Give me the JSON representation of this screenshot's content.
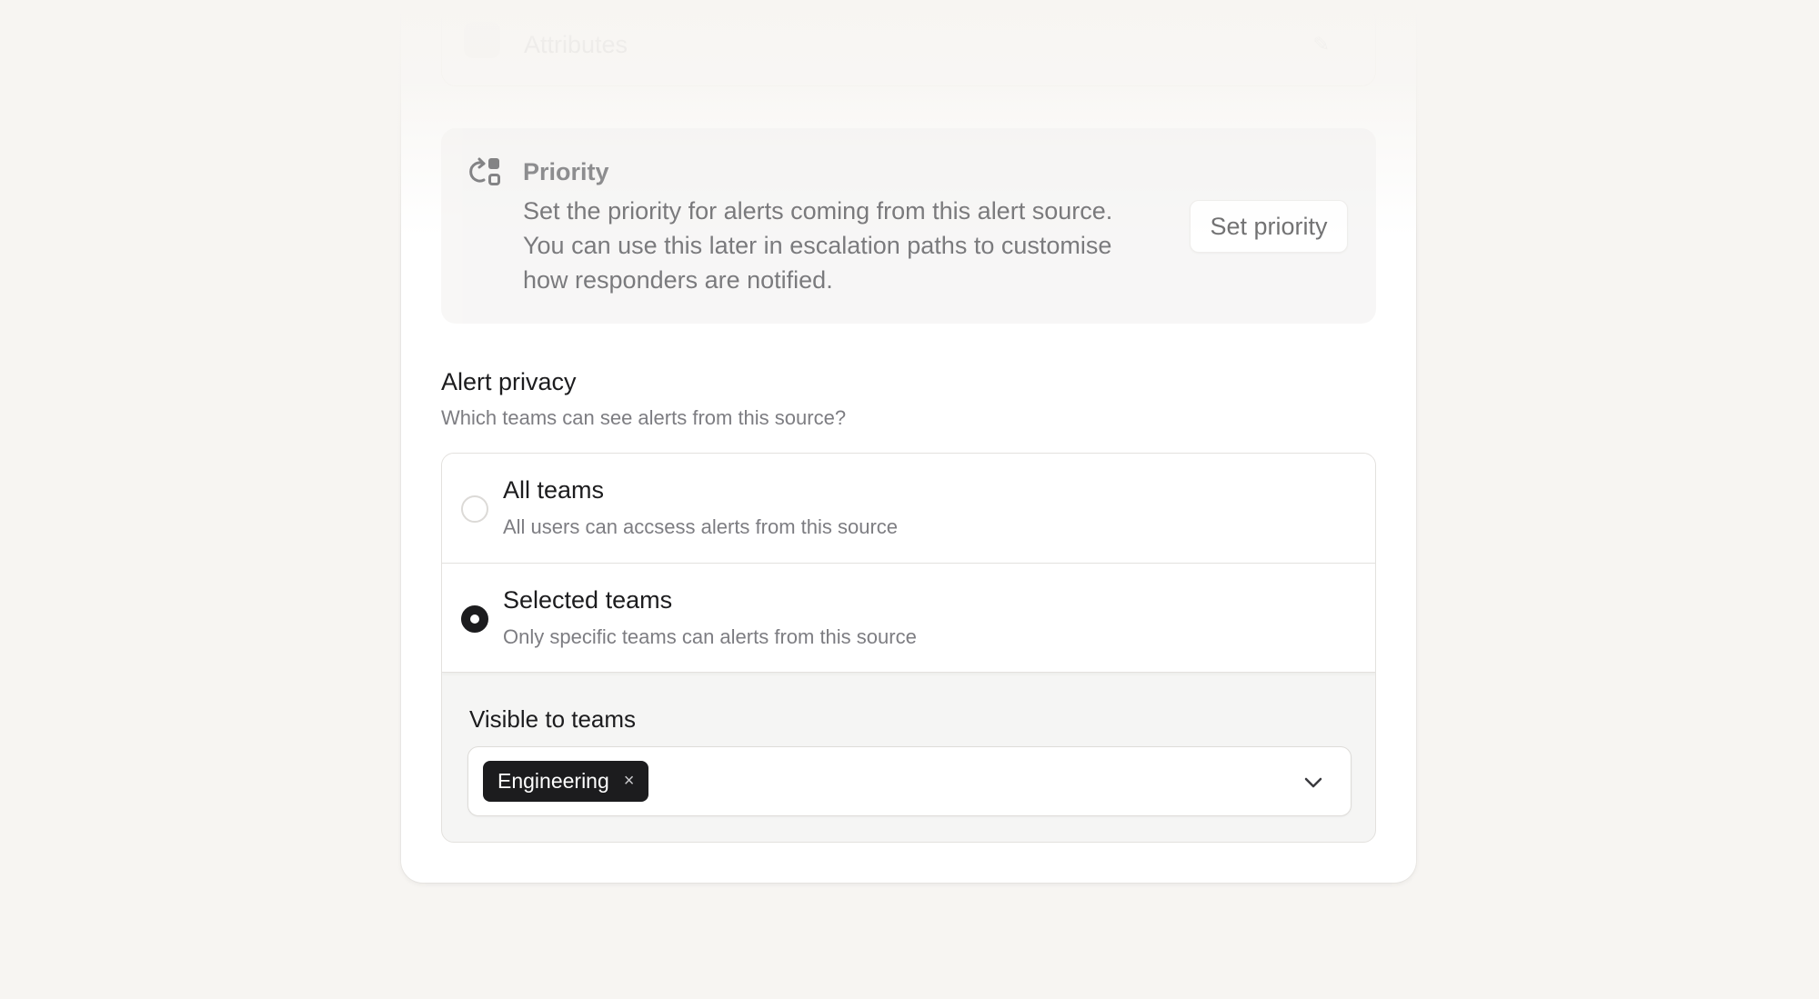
{
  "attributes": {
    "label": "Attributes"
  },
  "priority": {
    "title": "Priority",
    "description": "Set the priority for alerts coming from this alert source. You can use this later in escalation paths to customise how responders are notified.",
    "button_label": "Set priority"
  },
  "privacy": {
    "title": "Alert privacy",
    "subtitle": "Which teams can see alerts from this source?",
    "options": [
      {
        "title": "All teams",
        "description": "All users can accsess alerts from this source",
        "selected": false
      },
      {
        "title": "Selected teams",
        "description": "Only specific teams can alerts from this source",
        "selected": true
      }
    ],
    "visible_label": "Visible to teams",
    "selected_teams": [
      "Engineering"
    ],
    "remove_icon": "×"
  },
  "icons": {
    "priority": "priority-icon",
    "chevron": "chevron-down-icon",
    "edit": "pencil-icon"
  }
}
